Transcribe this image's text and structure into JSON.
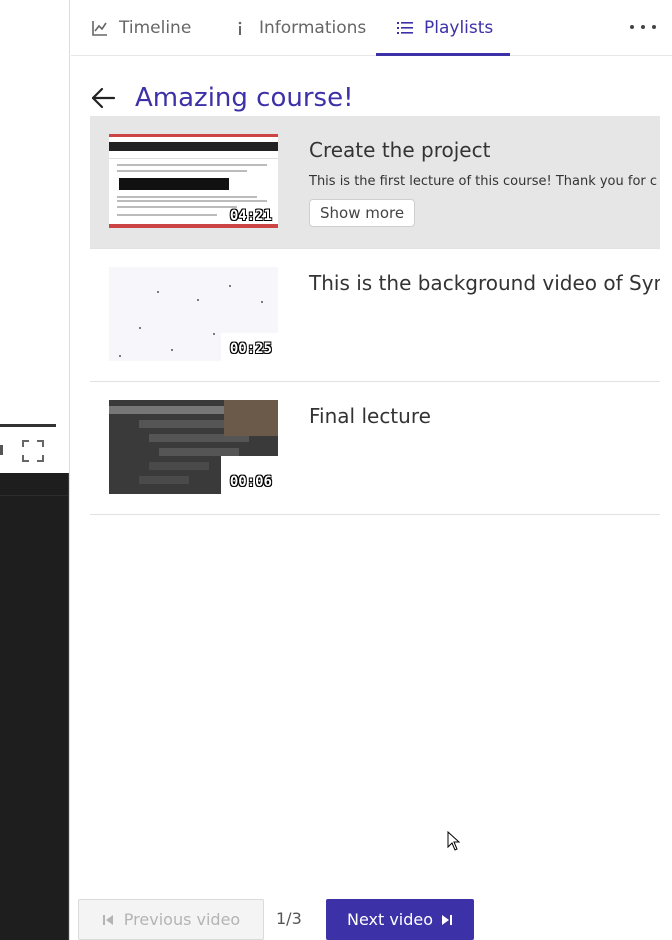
{
  "tabs": [
    {
      "label": "Timeline",
      "icon": "chart-line-icon"
    },
    {
      "label": "Informations",
      "icon": "info-icon"
    },
    {
      "label": "Playlists",
      "icon": "list-icon",
      "active": true
    }
  ],
  "more_icon": "more-dots-icon",
  "playlist": {
    "title": "Amazing course!",
    "back_icon": "arrow-left-icon"
  },
  "items": [
    {
      "title": "Create the project",
      "description": "This is the first lecture of this course! Thank you for c",
      "duration": "04:21",
      "show_more_label": "Show more",
      "active": true
    },
    {
      "title": "This is the background video of Synco",
      "duration": "00:25",
      "active": false
    },
    {
      "title": "Final lecture",
      "duration": "00:06",
      "active": false
    }
  ],
  "footer": {
    "prev_label": "Previous video",
    "counter": "1/3",
    "next_label": "Next video"
  },
  "colors": {
    "accent": "#3d31a8",
    "active_row": "#e6e6e6",
    "disabled_text": "#b4b4b4"
  }
}
